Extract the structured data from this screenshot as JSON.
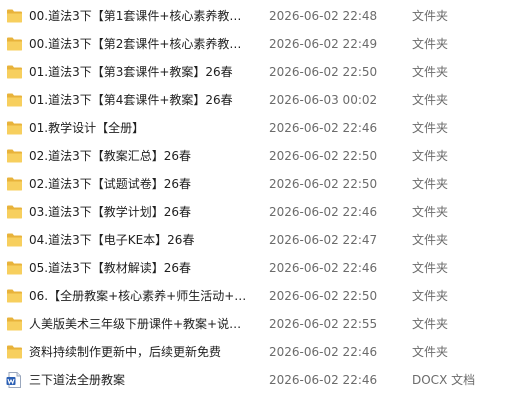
{
  "files": [
    {
      "name": "00.道法3下【第1套课件+核心素养教案...",
      "modified": "2026-06-02 22:48",
      "type": "文件夹",
      "icon": "folder-icon"
    },
    {
      "name": "00.道法3下【第2套课件+核心素养教案...",
      "modified": "2026-06-02 22:49",
      "type": "文件夹",
      "icon": "folder-icon"
    },
    {
      "name": "01.道法3下【第3套课件+教案】26春",
      "modified": "2026-06-02 22:50",
      "type": "文件夹",
      "icon": "folder-icon"
    },
    {
      "name": "01.道法3下【第4套课件+教案】26春",
      "modified": "2026-06-03 00:02",
      "type": "文件夹",
      "icon": "folder-icon"
    },
    {
      "name": "01.教学设计【全册】",
      "modified": "2026-06-02 22:46",
      "type": "文件夹",
      "icon": "folder-icon"
    },
    {
      "name": "02.道法3下【教案汇总】26春",
      "modified": "2026-06-02 22:50",
      "type": "文件夹",
      "icon": "folder-icon"
    },
    {
      "name": "02.道法3下【试题试卷】26春",
      "modified": "2026-06-02 22:50",
      "type": "文件夹",
      "icon": "folder-icon"
    },
    {
      "name": "03.道法3下【教学计划】26春",
      "modified": "2026-06-02 22:46",
      "type": "文件夹",
      "icon": "folder-icon"
    },
    {
      "name": "04.道法3下【电子KE本】26春",
      "modified": "2026-06-02 22:47",
      "type": "文件夹",
      "icon": "folder-icon"
    },
    {
      "name": "05.道法3下【教材解读】26春",
      "modified": "2026-06-02 22:46",
      "type": "文件夹",
      "icon": "folder-icon"
    },
    {
      "name": "06.【全册教案+核心素养+师生活动+二...",
      "modified": "2026-06-02 22:50",
      "type": "文件夹",
      "icon": "folder-icon"
    },
    {
      "name": "人美版美术三年级下册课件+教案+说课...",
      "modified": "2026-06-02 22:55",
      "type": "文件夹",
      "icon": "folder-icon"
    },
    {
      "name": "资料持续制作更新中，后续更新免费",
      "modified": "2026-06-02 22:46",
      "type": "文件夹",
      "icon": "folder-icon"
    },
    {
      "name": "三下道法全册教案",
      "modified": "2026-06-02 22:46",
      "type": "DOCX 文档",
      "icon": "word-doc-icon"
    }
  ],
  "colors": {
    "folder_back": "#e8b33b",
    "folder_front": "#f7cf5e",
    "word_blue": "#2b5fb4",
    "meta_text": "#6b6b6b"
  }
}
